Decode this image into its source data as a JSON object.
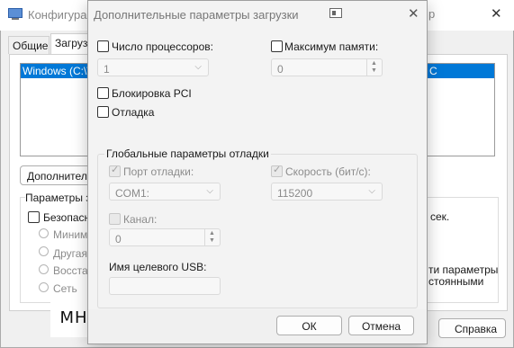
{
  "background_window": {
    "title": "Конфигурац",
    "title_suffix": "р",
    "tabs": [
      "Общие",
      "Загрузк"
    ],
    "list_item": "Windows (C:\\W",
    "list_item_right": "C",
    "advanced_button": "Дополнител",
    "boot_params_label": "Параметры з",
    "safe_boot_label": "Безопасн",
    "radio_items": [
      "Минима",
      "Другая",
      "Восстан",
      "Сеть"
    ],
    "timeout_suffix": "сек.",
    "right_text_1": "ти параметры",
    "right_text_2": "стоянными",
    "help_button": "Справка"
  },
  "dialog": {
    "title": "Дополнительные параметры загрузки",
    "num_proc_label": "Число процессоров:",
    "num_proc_value": "1",
    "max_mem_label": "Максимум памяти:",
    "max_mem_value": "0",
    "pci_lock_label": "Блокировка PCI",
    "debug_label": "Отладка",
    "global_debug_label": "Глобальные параметры отладки",
    "debug_port_label": "Порт отладки:",
    "debug_port_value": "COM1:",
    "baud_label": "Скорость (бит/с):",
    "baud_value": "115200",
    "channel_label": "Канал:",
    "channel_value": "0",
    "usb_target_label": "Имя целевого USB:",
    "usb_target_value": "",
    "ok_button": "ОК",
    "cancel_button": "Отмена"
  },
  "watermark_text": "МНТ"
}
